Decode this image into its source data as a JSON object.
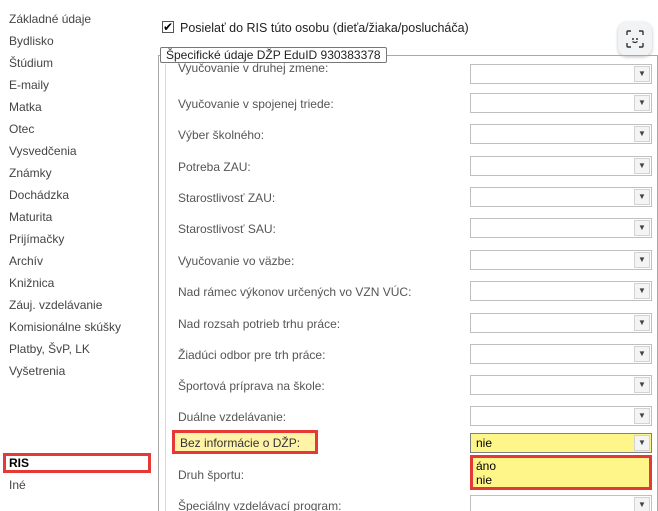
{
  "sidebar": {
    "items": [
      {
        "label": "Základné údaje"
      },
      {
        "label": "Bydlisko"
      },
      {
        "label": "Štúdium"
      },
      {
        "label": "E-maily"
      },
      {
        "label": "Matka"
      },
      {
        "label": "Otec"
      },
      {
        "label": "Vysvedčenia"
      },
      {
        "label": "Známky"
      },
      {
        "label": "Dochádzka"
      },
      {
        "label": "Maturita"
      },
      {
        "label": "Prijímačky"
      },
      {
        "label": "Archív"
      },
      {
        "label": "Knižnica"
      },
      {
        "label": "Záuj. vzdelávanie"
      },
      {
        "label": "Komisionálne skúšky"
      },
      {
        "label": "Platby, ŠvP, LK"
      },
      {
        "label": "Vyšetrenia"
      },
      {
        "label": "RIS"
      },
      {
        "label": "Iné"
      }
    ],
    "active": "RIS"
  },
  "main": {
    "send_checkbox": {
      "label": "Posielať do RIS túto osobu (dieťa/žiaka/poslucháča)",
      "checked": true
    },
    "group_title": "Špecifické údaje DŽP EduID 930383378",
    "fields": [
      {
        "label": "Vyučovanie v druhej zmene:",
        "value": ""
      },
      {
        "label": "Vyučovanie v spojenej triede:",
        "value": ""
      },
      {
        "label": "Výber školného:",
        "value": ""
      },
      {
        "label": "Potreba ZAU:",
        "value": ""
      },
      {
        "label": "Starostlivosť ZAU:",
        "value": ""
      },
      {
        "label": "Starostlivosť SAU:",
        "value": ""
      },
      {
        "label": "Vyučovanie vo väzbe:",
        "value": ""
      },
      {
        "label": "Nad rámec výkonov určených vo VZN VÚC:",
        "value": ""
      },
      {
        "label": "Nad rozsah potrieb trhu práce:",
        "value": ""
      },
      {
        "label": "Žiadúci odbor pre trh práce:",
        "value": ""
      },
      {
        "label": "Športová príprava na škole:",
        "value": ""
      },
      {
        "label": "Duálne vzdelávanie:",
        "value": ""
      },
      {
        "label": "Bez informácie o DŽP:",
        "value": "nie"
      },
      {
        "label": "Druh športu:",
        "value": ""
      },
      {
        "label": "Špeciálny vzdelávací program:",
        "value": ""
      }
    ],
    "dropdown_options": [
      "áno",
      "nie"
    ]
  },
  "colors": {
    "highlight_border": "#e53935",
    "highlight_fill": "#fff68a"
  },
  "icons": {
    "capture": "screen-capture-icon",
    "combo_arrow": "chevron-down-icon",
    "check": "check-icon"
  }
}
